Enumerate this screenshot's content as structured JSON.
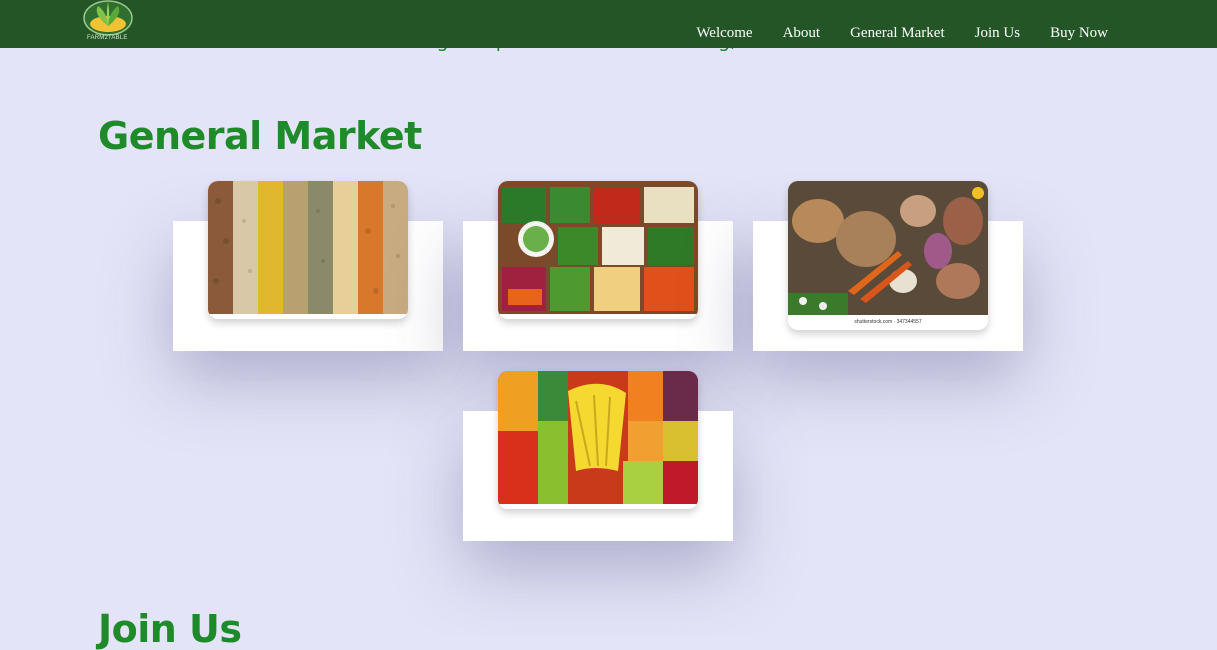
{
  "intro": {
    "text": "for where the farmer receives the highest price. For the time being, the service is free."
  },
  "navbar": {
    "logo_text": "FARM2TABLE",
    "links": [
      "Welcome",
      "About",
      "General Market",
      "Join Us",
      "Buy Now"
    ]
  },
  "sections": {
    "market_title": "General Market",
    "join_title": "Join Us"
  },
  "cards": [
    {
      "name": "grains",
      "caption": ""
    },
    {
      "name": "vegetables",
      "caption": ""
    },
    {
      "name": "root-vegetables",
      "caption": "shutterstock.com · 347344557"
    },
    {
      "name": "fruits",
      "caption": ""
    }
  ],
  "colors": {
    "nav_bg": "#245526",
    "page_bg": "#e4e4f8",
    "accent_green": "#1f8a2a"
  }
}
